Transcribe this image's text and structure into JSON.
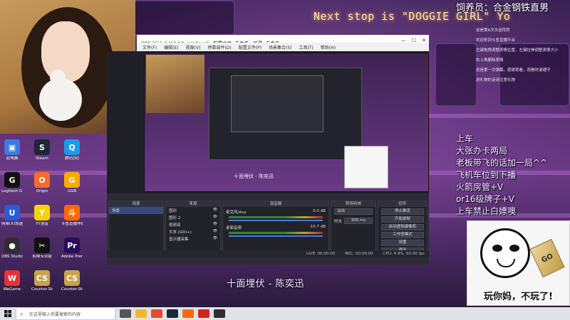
{
  "stream": {
    "neon_sign": "Next stop is \"DOGGIE GIRL\" Yo",
    "feeder_title": "饲养员：合金钢铁直男",
    "song_title": "十面埋伏 - 陈奕迅"
  },
  "rules": [
    "上车",
    "大张办卡两局",
    "老板带飞的话加一局^^",
    "飞机车位到下播",
    "火箭房管+V",
    "or16级牌子+V",
    "上车禁止白嫖噢"
  ],
  "chat_lines": [
    "这是第6次次送拜拜",
    "欢迎来到斗鱼直播平台",
    "左键拖拽调整表情位置，左键拉伸调整表情大小",
    "右上角删除表情",
    "这是第一次弹幕，感谢观看，观看时请遵守",
    "送礼物的话请注意礼物"
  ],
  "meme": {
    "caption": "玩你妈，不玩了!",
    "card_text": "GO"
  },
  "obs": {
    "window_title": "OBS 26.1.2 (64-bit, windows) - 配置文件: 未命名 - 场景: 未命名",
    "menus": [
      "文件(F)",
      "编辑(E)",
      "视图(V)",
      "停靠部件(D)",
      "配置文件(P)",
      "场景集合(S)",
      "工具(T)",
      "帮助(H)"
    ],
    "preview_song": "十面埋伏 - 陈奕迅",
    "dock_titles": [
      "场景",
      "来源",
      "混音器",
      "转场特效",
      "控件"
    ],
    "scenes": [
      "场景"
    ],
    "sources": [
      "图形",
      "图形 2",
      "视频亮",
      "文本 (GDI+)",
      "显示器采集"
    ],
    "mixer": [
      {
        "name": "麦克风/Aux",
        "level": "0.0 dB"
      },
      {
        "name": "桌面音频",
        "level": "-10.7 dB"
      }
    ],
    "transition": {
      "type": "淡出",
      "duration_label": "时长",
      "duration": "300 ms"
    },
    "controls": [
      "停止推流",
      "开始录制",
      "启动虚拟摄像机",
      "工作室模式",
      "设置",
      "退出"
    ],
    "status": {
      "live": "LIVE: 00:00:00",
      "rec": "REC: 00:00:00",
      "cpu": "CPU: 4.9%, 60.00 fps"
    }
  },
  "desktop_icons": [
    {
      "label": "此电脑",
      "color": "#3d7be0",
      "glyph": "▣"
    },
    {
      "label": "Steam",
      "color": "#1b2838",
      "glyph": "S"
    },
    {
      "label": "腾讯QQ",
      "color": "#1a9be6",
      "glyph": "Q"
    },
    {
      "label": "Logitech G HUB",
      "color": "#111111",
      "glyph": "G"
    },
    {
      "label": "Origin",
      "color": "#f56c2d",
      "glyph": "O"
    },
    {
      "label": "GGB",
      "color": "#ffaa00",
      "glyph": "G"
    },
    {
      "label": "网易UU加速器",
      "color": "#2a5ad8",
      "glyph": "U"
    },
    {
      "label": "YY语音",
      "color": "#f5d300",
      "glyph": "Y"
    },
    {
      "label": "斗鱼直播伴侣",
      "color": "#ff6a00",
      "glyph": "斗"
    },
    {
      "label": "OBS Studio",
      "color": "#302e31",
      "glyph": "●"
    },
    {
      "label": "剪映专业版",
      "color": "#111111",
      "glyph": "✂"
    },
    {
      "label": "Adobe Premiere",
      "color": "#2a0b5c",
      "glyph": "Pr"
    },
    {
      "label": "WeGame",
      "color": "#e23434",
      "glyph": "W"
    },
    {
      "label": "Counter-Strike Global Off...",
      "color": "#c9a24a",
      "glyph": "CS"
    },
    {
      "label": "Counter-Strike Global Off...",
      "color": "#c9a24a",
      "glyph": "CS"
    }
  ],
  "taskbar": {
    "search_placeholder": "在这里输入你要搜索的内容"
  }
}
